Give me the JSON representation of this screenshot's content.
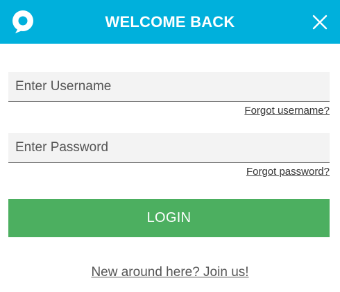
{
  "header": {
    "title": "WELCOME BACK",
    "logo_icon": "chat-bubble-logo-icon",
    "close_icon": "close-icon",
    "background_color": "#00b0dc"
  },
  "form": {
    "username": {
      "placeholder": "Enter Username",
      "value": ""
    },
    "forgot_username_label": "Forgot username?",
    "password": {
      "placeholder": "Enter Password",
      "value": ""
    },
    "forgot_password_label": "Forgot password?",
    "login_label": "LOGIN",
    "login_color": "#4caf60"
  },
  "footer": {
    "join_label": "New around here? Join us!"
  }
}
